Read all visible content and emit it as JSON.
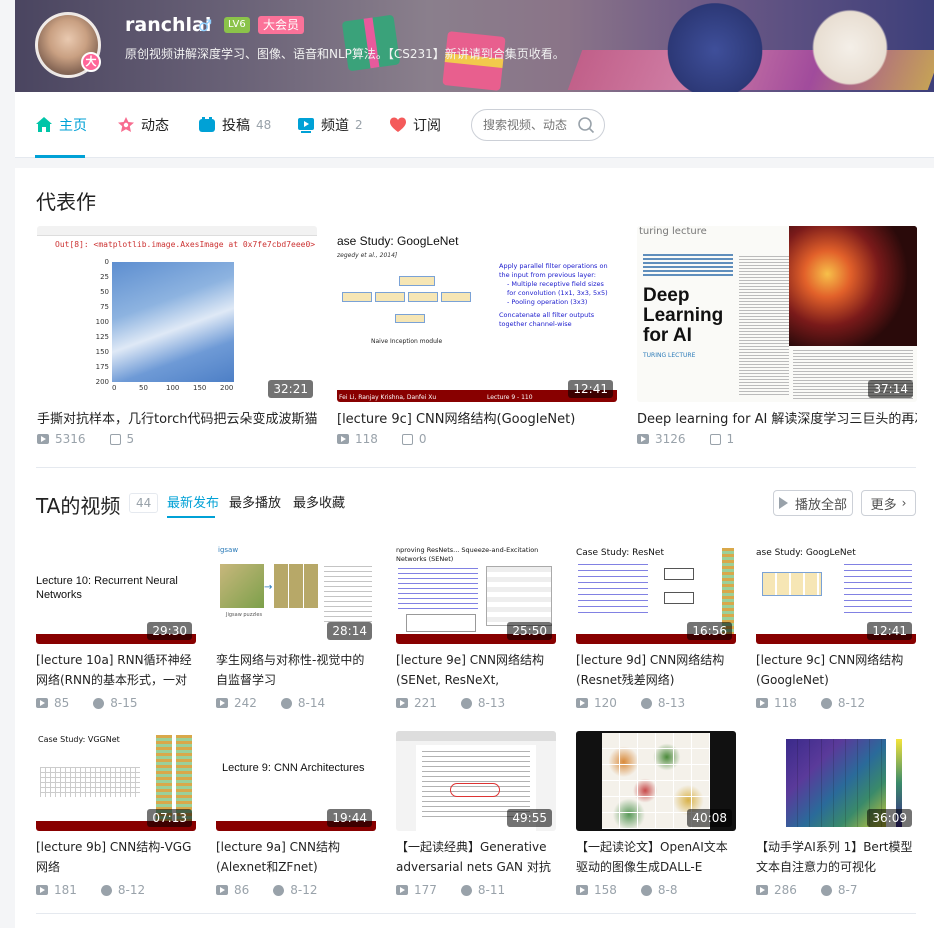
{
  "user": {
    "name": "ranchlai",
    "gender_icon": "male",
    "level": "LV6",
    "vip_label": "大会员",
    "avatar_badge": "大",
    "signature": "原创视频讲解深度学习、图像、语音和NLP算法。【CS231】新讲请到合集页收看。"
  },
  "nav": {
    "items": [
      {
        "label": "主页",
        "count": "",
        "icon": "home-icon"
      },
      {
        "label": "动态",
        "count": "",
        "icon": "dynamic-icon"
      },
      {
        "label": "投稿",
        "count": "48",
        "icon": "upload-icon"
      },
      {
        "label": "频道",
        "count": "2",
        "icon": "channel-icon"
      },
      {
        "label": "订阅",
        "count": "",
        "icon": "heart-icon"
      }
    ],
    "search_placeholder": "搜索视频、动态"
  },
  "featured": {
    "title": "代表作",
    "videos": [
      {
        "title": "手撕对抗样本，几行torch代码把云朵变成波斯猫(对",
        "duration": "32:21",
        "plays": "5316",
        "comments": "5"
      },
      {
        "title": "[lecture 9c] CNN网络结构(GoogleNet)",
        "duration": "12:41",
        "plays": "118",
        "comments": "0"
      },
      {
        "title": "Deep learning for AI 解读深度学习三巨头的再次合作",
        "duration": "37:14",
        "plays": "3126",
        "comments": "1"
      }
    ]
  },
  "thumb_text": {
    "jupyter_out": "Out[8]: <matplotlib.image.AxesImage at 0x7fe7cbd7eee0>",
    "jupyter_ticks": [
      "0",
      "25",
      "50",
      "75",
      "100",
      "125",
      "150",
      "175",
      "200"
    ],
    "jupyter_xticks": [
      "0",
      "50",
      "100",
      "150",
      "200"
    ],
    "google_title": "ase Study: GoogLeNet",
    "google_sub": "zegedy et al., 2014]",
    "google_bullets": [
      "Apply parallel filter operations on the input from previous layer:",
      "- Multiple receptive field sizes for convolution (1x1, 3x3, 5x5)",
      "- Pooling operation (3x3)",
      "Concatenate all filter outputs together channel-wise"
    ],
    "google_module": "Naive Inception module",
    "google_footer": "Fei Li, Ranjay Krishna, Danfei Xu",
    "google_lecture": "Lecture 9 -   110",
    "turing_label": "turing lecture",
    "turing_headline": "Deep Learning for AI",
    "turing_sub": "TURING LECTURE",
    "rnn_title": "Lecture 10: Recurrent Neural Networks",
    "jigsaw_label": "igsaw",
    "jigsaw_caption": "Jigsaw puzzles",
    "senet_title": "nproving ResNets... Squeeze-and-Excitation Networks (SENet)",
    "resnet_title": "Case Study: ResNet",
    "vgg_title": "Case Study: VGGNet",
    "cnn_arch_title": "Lecture 9: CNN Architectures"
  },
  "ta": {
    "title": "TA的视频",
    "count": "44",
    "tabs": [
      "最新发布",
      "最多播放",
      "最多收藏"
    ],
    "play_all": "播放全部",
    "more": "更多"
  },
  "videos": [
    {
      "title": "[lecture 10a] RNN循环神经网络(RNN的基本形式，一对",
      "duration": "29:30",
      "plays": "85",
      "date": "8-15"
    },
    {
      "title": "孪生网络与对称性-视觉中的自监督学习",
      "duration": "28:14",
      "plays": "242",
      "date": "8-14"
    },
    {
      "title": "[lecture 9e] CNN网络结构(SENet, ResNeXt, DenseNet,",
      "duration": "25:50",
      "plays": "221",
      "date": "8-13"
    },
    {
      "title": "[lecture 9d] CNN网络结构(Resnet残差网络)",
      "duration": "16:56",
      "plays": "120",
      "date": "8-13"
    },
    {
      "title": "[lecture 9c] CNN网络结构(GoogleNet)",
      "duration": "12:41",
      "plays": "118",
      "date": "8-12"
    },
    {
      "title": "[lecture 9b] CNN结构-VGG网络",
      "duration": "07:13",
      "plays": "181",
      "date": "8-12"
    },
    {
      "title": "[lecture 9a] CNN结构(Alexnet和ZFnet)",
      "duration": "19:44",
      "plays": "86",
      "date": "8-12"
    },
    {
      "title": "【一起读经典】Generative adversarial nets GAN 对抗网",
      "duration": "49:55",
      "plays": "177",
      "date": "8-11"
    },
    {
      "title": "【一起读论文】OpenAI文本驱动的图像生成DALL-E",
      "duration": "40:08",
      "plays": "158",
      "date": "8-8"
    },
    {
      "title": "【动手学AI系列 1】Bert模型文本自注意力的可视化",
      "duration": "36:09",
      "plays": "286",
      "date": "8-7"
    }
  ]
}
